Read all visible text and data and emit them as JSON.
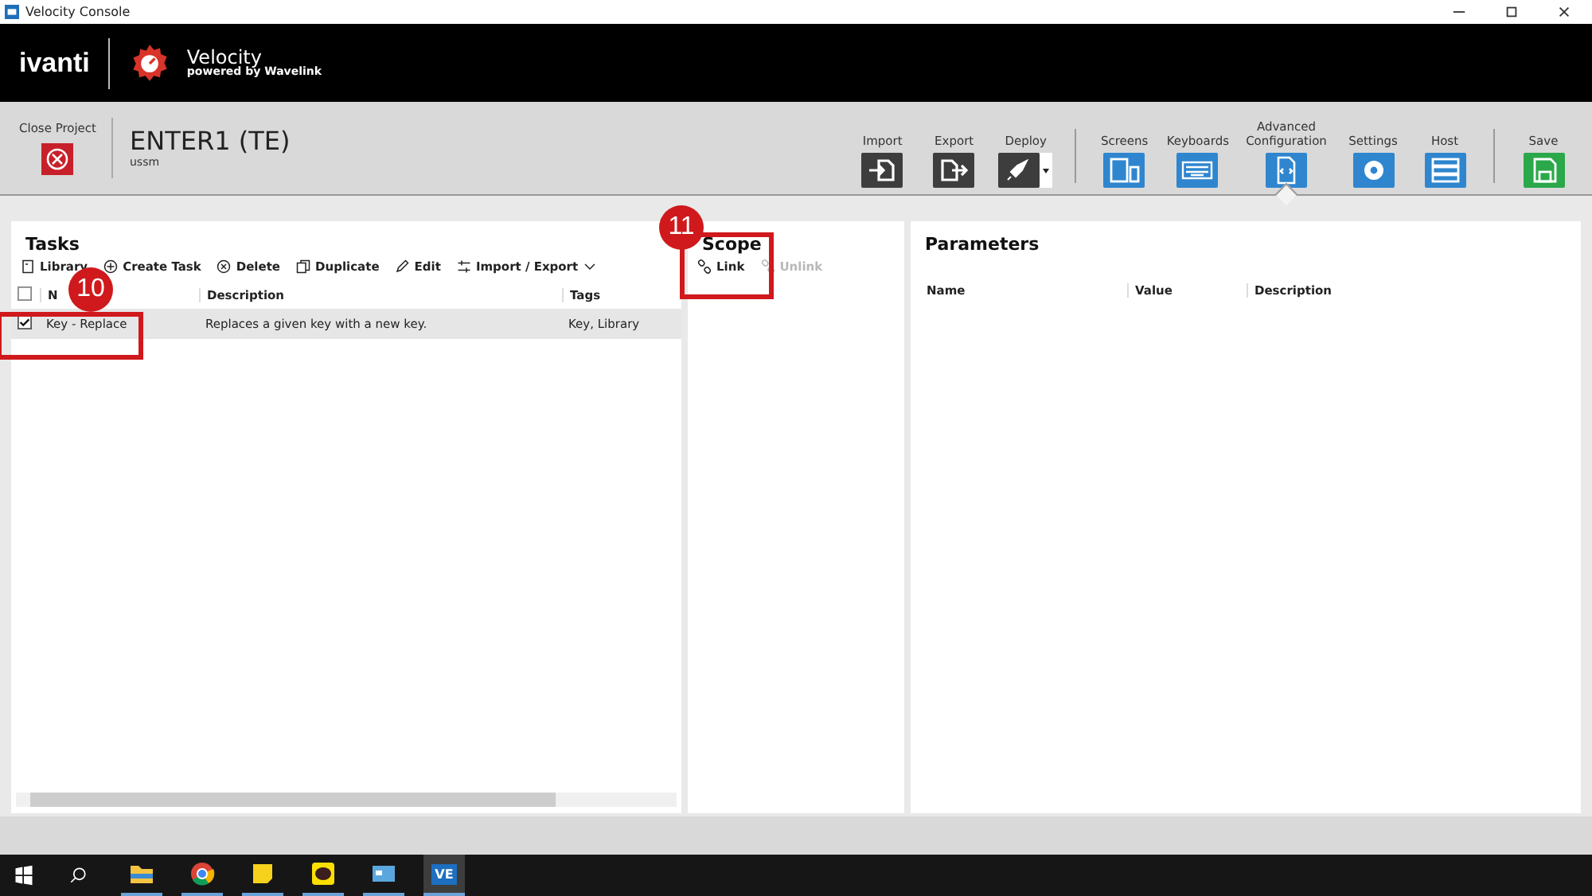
{
  "window": {
    "title": "Velocity Console"
  },
  "brand": {
    "company": "ivanti",
    "product": "Velocity",
    "tagline": "powered by Wavelink"
  },
  "project": {
    "close_label": "Close Project",
    "name": "ENTER1 (TE)",
    "subtitle": "ussm"
  },
  "toolbar": [
    {
      "label": "Import",
      "kind": "dark",
      "selected": false
    },
    {
      "label": "Export",
      "kind": "dark",
      "selected": false
    },
    {
      "label": "Deploy",
      "kind": "dark",
      "selected": false,
      "dropdown": true
    },
    {
      "label": "Screens",
      "kind": "blue",
      "selected": false
    },
    {
      "label": "Keyboards",
      "kind": "blue",
      "selected": false
    },
    {
      "label": "Advanced Configuration",
      "kind": "blue",
      "selected": true
    },
    {
      "label": "Settings",
      "kind": "blue",
      "selected": false
    },
    {
      "label": "Host",
      "kind": "blue",
      "selected": false
    },
    {
      "label": "Save",
      "kind": "green",
      "selected": false
    }
  ],
  "tasks": {
    "title": "Tasks",
    "actions": [
      {
        "label": "Library",
        "disabled": false
      },
      {
        "label": "Create Task",
        "disabled": false
      },
      {
        "label": "Delete",
        "disabled": false
      },
      {
        "label": "Duplicate",
        "disabled": false
      },
      {
        "label": "Edit",
        "disabled": false
      },
      {
        "label": "Import / Export",
        "disabled": false,
        "dropdown": true
      }
    ],
    "header_checked": false,
    "columns": [
      "N",
      "Description",
      "Tags"
    ],
    "rows": [
      {
        "checked": true,
        "selected": true,
        "cells": [
          "Key - Replace",
          "Replaces a given key with a new key.",
          "Key, Library"
        ]
      }
    ]
  },
  "scope": {
    "title": "Scope",
    "actions": [
      {
        "label": "Link",
        "disabled": false
      },
      {
        "label": "Unlink",
        "disabled": true
      }
    ]
  },
  "parameters": {
    "title": "Parameters",
    "columns": [
      "Name",
      "Value",
      "Description"
    ]
  },
  "annotations": [
    {
      "label": "10"
    },
    {
      "label": "11"
    }
  ],
  "taskbar": [
    {
      "kind": "folder",
      "selected": false
    },
    {
      "kind": "chrome",
      "selected": false
    },
    {
      "kind": "notes",
      "selected": false
    },
    {
      "kind": "chat",
      "selected": false
    },
    {
      "kind": "window",
      "selected": false
    },
    {
      "kind": "app",
      "label": "VE",
      "selected": true
    }
  ]
}
